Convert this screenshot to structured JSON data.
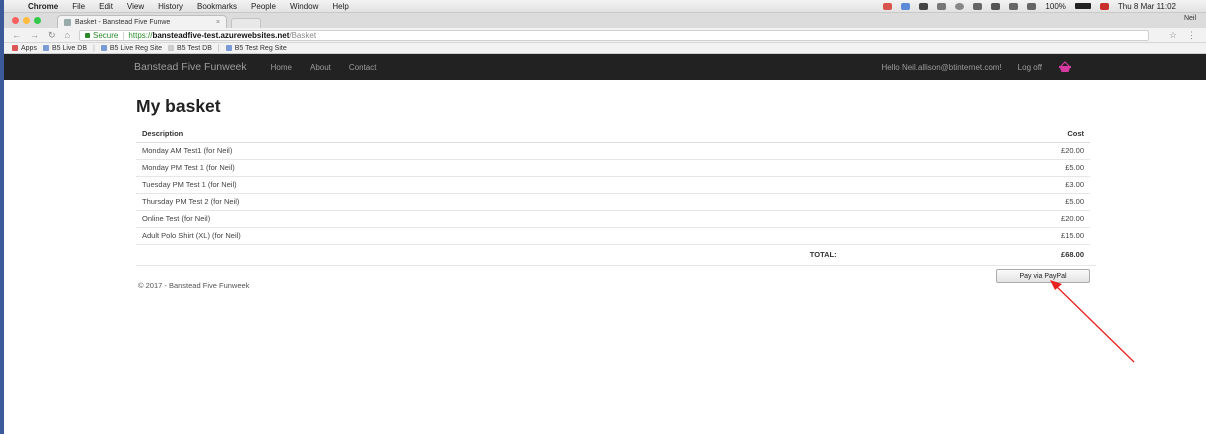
{
  "menubar": {
    "app": "Chrome",
    "items": [
      "File",
      "Edit",
      "View",
      "History",
      "Bookmarks",
      "People",
      "Window",
      "Help"
    ],
    "battery_percent": "100%",
    "clock": "Thu 8 Mar  11:02"
  },
  "browser": {
    "tab_title": "Basket - Banstead Five Funwe",
    "profile": "Neil",
    "secure_label": "Secure",
    "url_scheme": "https://",
    "url_host": "bansteadfive-test.azurewebsites.net",
    "url_path": "/Basket",
    "bookmarks": [
      "Apps",
      "B5 Live DB",
      "B5 Live Reg Site",
      "B5 Test DB",
      "B5 Test Reg Site"
    ]
  },
  "site": {
    "brand": "Banstead Five Funweek",
    "nav": [
      "Home",
      "About",
      "Contact"
    ],
    "greeting": "Hello Neil.allison@btinternet.com!",
    "logoff": "Log off"
  },
  "basket": {
    "title": "My basket",
    "col_description": "Description",
    "col_cost": "Cost",
    "items": [
      {
        "description": "Monday AM Test1 (for Neil)",
        "cost": "£20.00"
      },
      {
        "description": "Monday PM Test 1 (for Neil)",
        "cost": "£5.00"
      },
      {
        "description": "Tuesday PM Test 1 (for Neil)",
        "cost": "£3.00"
      },
      {
        "description": "Thursday PM Test 2 (for Neil)",
        "cost": "£5.00"
      },
      {
        "description": "Online Test (for Neil)",
        "cost": "£20.00"
      },
      {
        "description": "Adult Polo Shirt (XL) (for Neil)",
        "cost": "£15.00"
      }
    ],
    "total_label": "TOTAL:",
    "total_value": "£68.00",
    "pay_button": "Pay via PayPal"
  },
  "footer": "© 2017 - Banstead Five Funweek",
  "colors": {
    "navbar": "#222222",
    "basket_icon": "#d63aa0",
    "annotation_arrow": "#e8231f"
  }
}
